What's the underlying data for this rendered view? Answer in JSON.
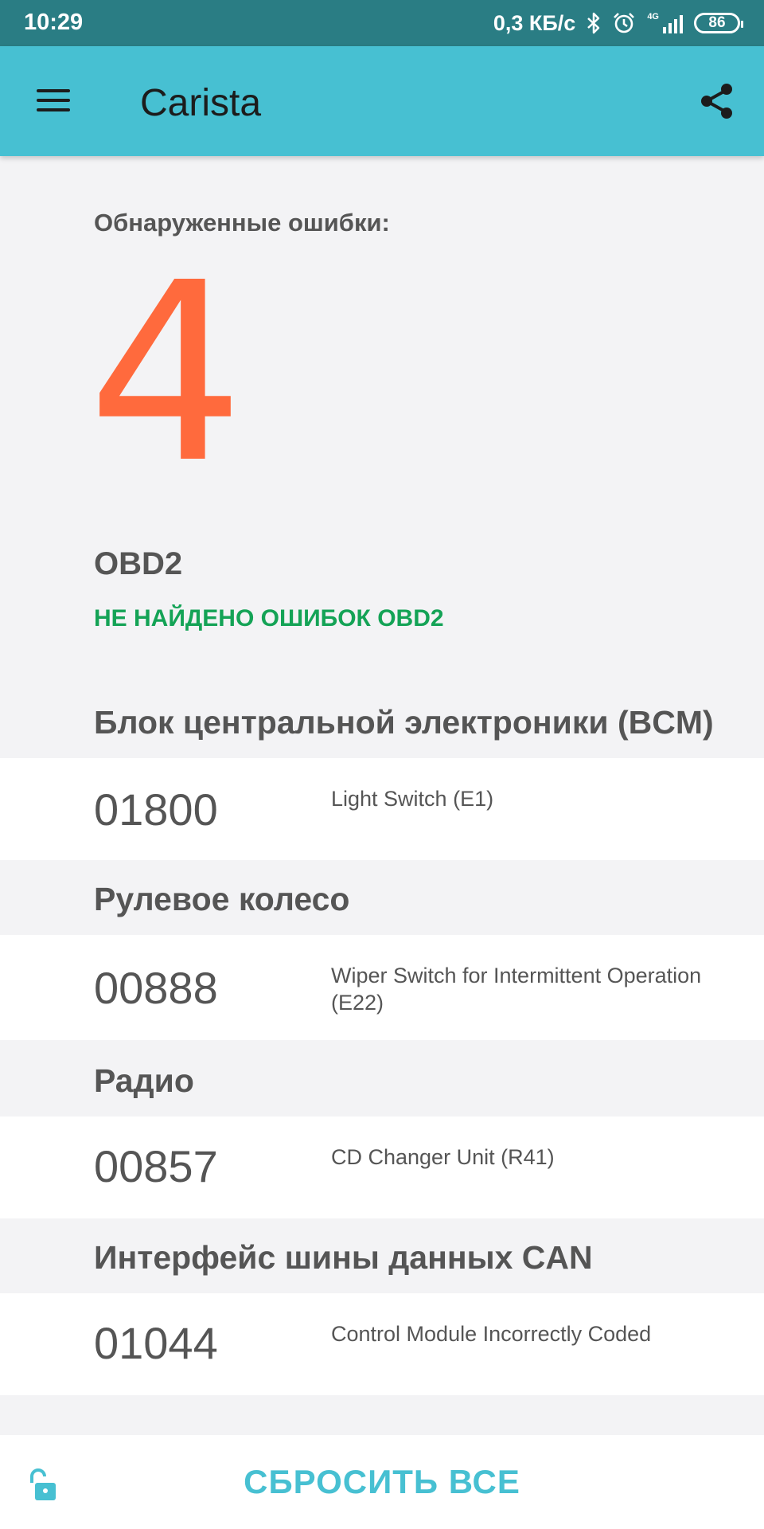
{
  "status_bar": {
    "time": "10:29",
    "net_speed": "0,3 КБ/с",
    "network_type": "4G",
    "battery": "86",
    "icons": [
      "bluetooth-icon",
      "alarm-icon",
      "signal-icon",
      "battery-icon"
    ]
  },
  "app_bar": {
    "title": "Carista",
    "background": "#47c0d2",
    "icons": [
      "menu-icon",
      "share-icon"
    ]
  },
  "summary": {
    "label": "Обнаруженные ошибки:",
    "count": "4",
    "count_color": "#ff6a3d"
  },
  "obd2": {
    "title": "OBD2",
    "status": "НЕ НАЙДЕНО ОШИБОК OBD2",
    "status_color": "#14a356"
  },
  "modules": [
    {
      "title": "Блок центральной электроники (BCM)",
      "code": "01800",
      "description": "Light Switch (E1)"
    },
    {
      "title": "Рулевое колесо",
      "code": "00888",
      "description": "Wiper Switch for Intermittent Operation (E22)"
    },
    {
      "title": "Радио",
      "code": "00857",
      "description": "CD Changer Unit (R41)"
    },
    {
      "title": "Интерфейс шины данных CAN",
      "code": "01044",
      "description": "Control Module Incorrectly Coded"
    }
  ],
  "bottom_bar": {
    "reset_label": "СБРОСИТЬ ВСЕ",
    "lock_icon": "unlock-icon"
  }
}
